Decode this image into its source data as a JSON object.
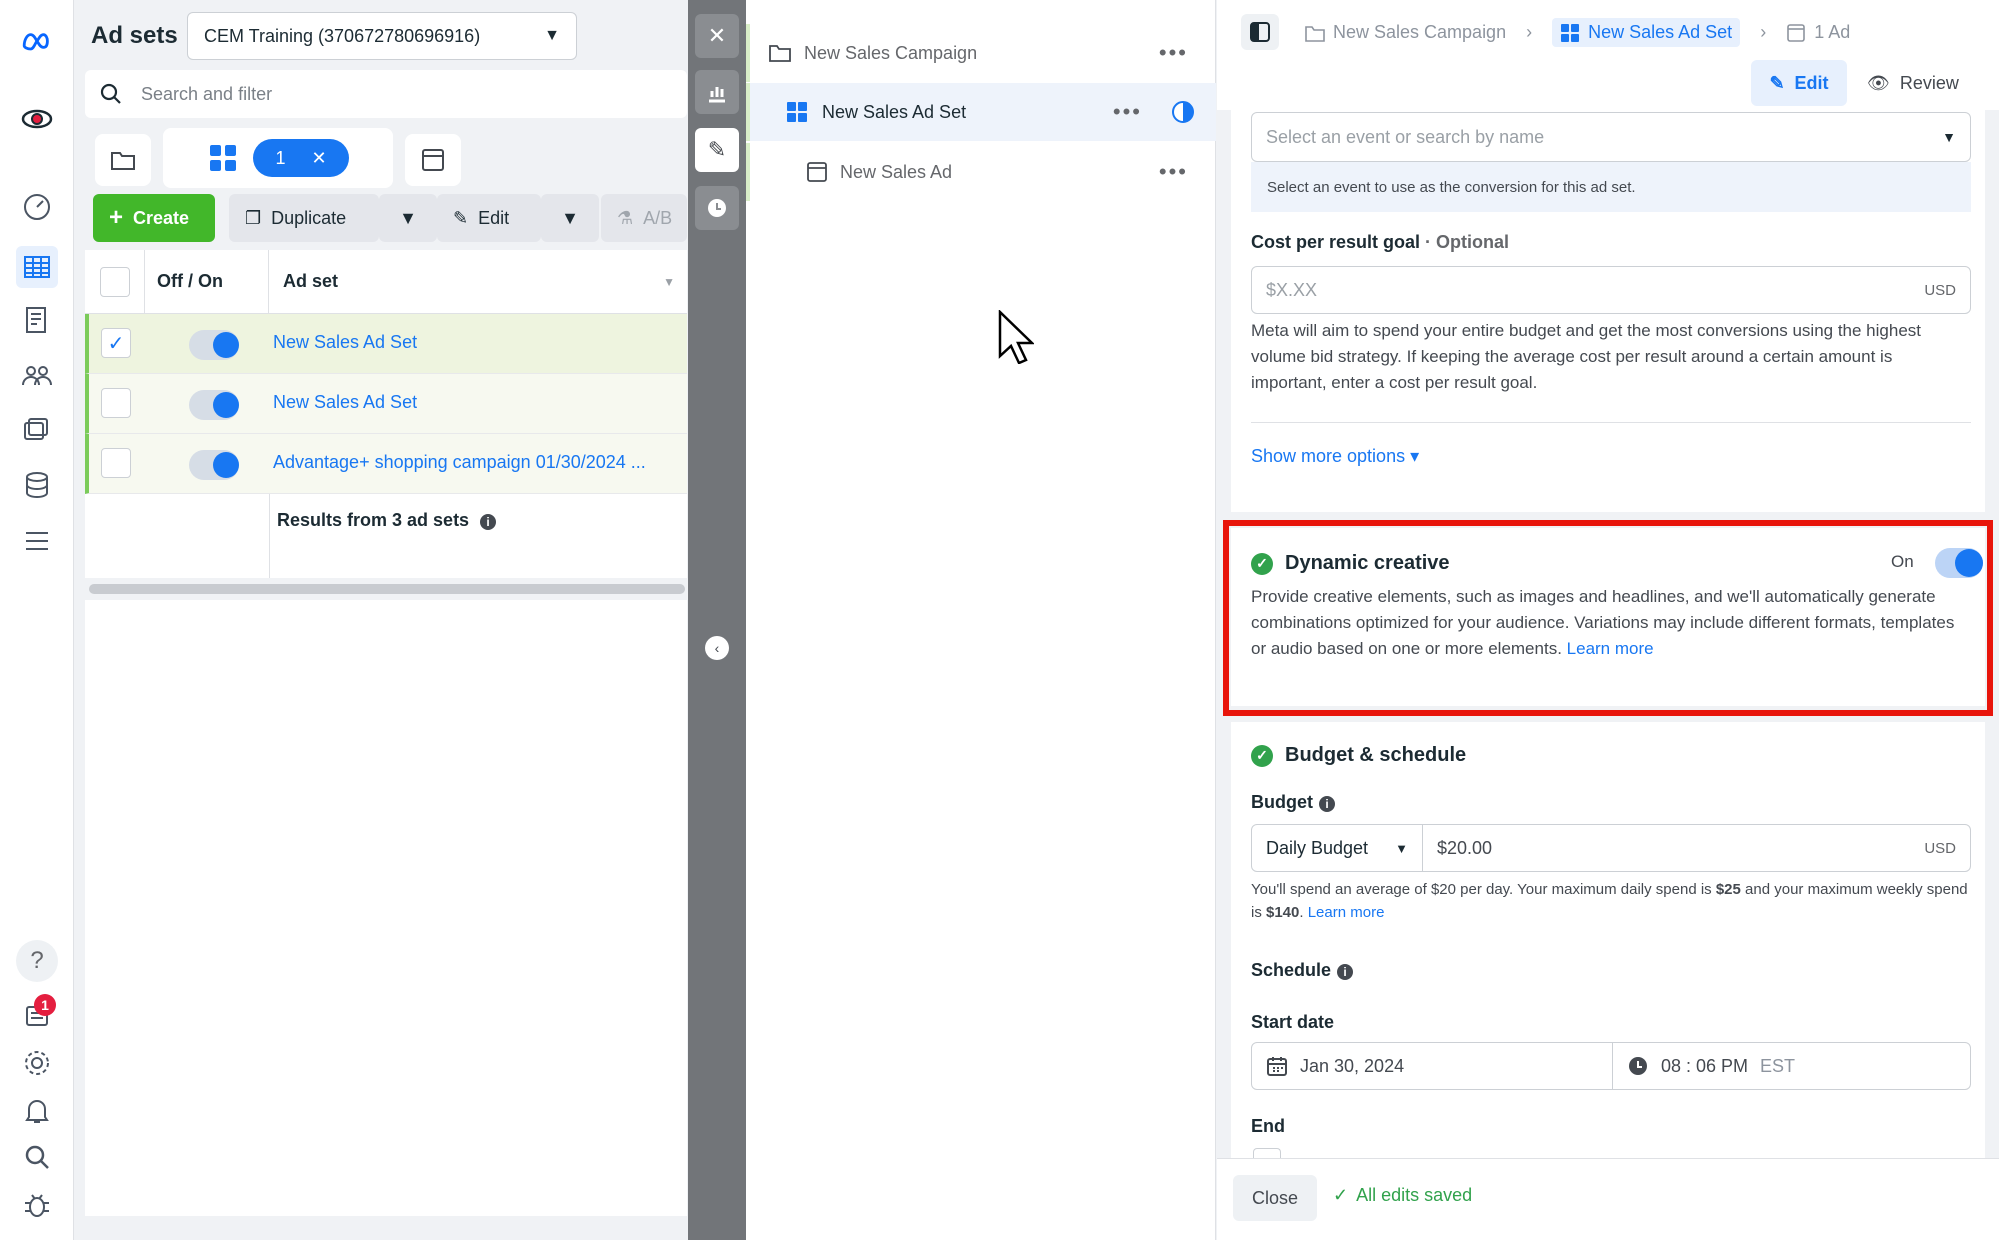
{
  "rail": {
    "notification_count": "1"
  },
  "adsets_panel": {
    "title": "Ad sets",
    "account_selector": "CEM Training (370672780696916)",
    "search_placeholder": "Search and filter",
    "selected_chip_count": "1",
    "toolbar": {
      "create": "Create",
      "duplicate": "Duplicate",
      "edit": "Edit",
      "ab_test": "A/B"
    },
    "columns": {
      "off_on": "Off / On",
      "ad_set": "Ad set"
    },
    "rows": [
      {
        "name": "New Sales Ad Set",
        "checked": true,
        "on": true
      },
      {
        "name": "New Sales Ad Set",
        "checked": false,
        "on": true
      },
      {
        "name": "Advantage+ shopping campaign 01/30/2024 ...",
        "checked": false,
        "on": true
      }
    ],
    "results_text": "Results from 3 ad sets"
  },
  "tree": {
    "campaign": "New Sales Campaign",
    "adset": "New Sales Ad Set",
    "ad": "New Sales Ad",
    "more": "•••"
  },
  "editor": {
    "breadcrumb": {
      "campaign": "New Sales Campaign",
      "adset": "New Sales Ad Set",
      "ad": "1 Ad"
    },
    "edit_label": "Edit",
    "review_label": "Review",
    "event_placeholder": "Select an event or search by name",
    "event_help": "Select an event to use as the conversion for this ad set.",
    "cost_goal_label": "Cost per result goal",
    "cost_goal_optional": "· Optional",
    "cost_placeholder": "$X.XX",
    "currency": "USD",
    "cost_help": "Meta will aim to spend your entire budget and get the most conversions using the highest volume bid strategy. If keeping the average cost per result around a certain amount is important, enter a cost per result goal.",
    "show_more": "Show more options ▾",
    "dynamic_creative": {
      "title": "Dynamic creative",
      "toggle_label": "On",
      "description": "Provide creative elements, such as images and headlines, and we'll automatically generate combinations optimized for your audience. Variations may include different formats, templates or audio based on one or more elements.",
      "learn_more": "Learn more"
    },
    "budget_schedule": {
      "title": "Budget & schedule",
      "budget_label": "Budget",
      "budget_type": "Daily Budget",
      "budget_value": "$20.00",
      "budget_help_1": "You'll spend an average of $20 per day. Your maximum daily spend is ",
      "budget_help_max_daily": "$25",
      "budget_help_2": " and your maximum weekly spend is ",
      "budget_help_max_weekly": "$140",
      "budget_help_3": ". ",
      "learn_more": "Learn more",
      "schedule_label": "Schedule",
      "start_date_label": "Start date",
      "start_date": "Jan 30, 2024",
      "start_time": "08 : 06 PM",
      "timezone": "EST",
      "end_label": "End"
    },
    "footer": {
      "close": "Close",
      "saved": "All edits saved"
    }
  },
  "colors": {
    "accent": "#1877f2",
    "create_green": "#42b72a",
    "highlight_red": "#e8150b",
    "status_green": "#31a24c"
  }
}
